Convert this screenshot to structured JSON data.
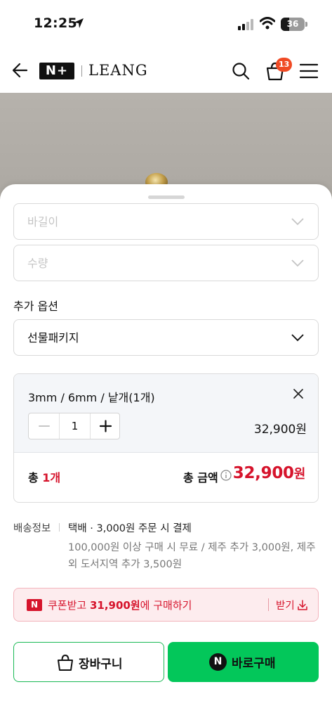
{
  "status_bar": {
    "time": "12:25",
    "battery_level": "36",
    "battery_fraction": 0.36
  },
  "header": {
    "np_logo": "N+",
    "brand_logo": "LEANG",
    "cart_count": "13"
  },
  "sheet": {
    "select_size_placeholder": "바길이",
    "select_qty_placeholder": "수량",
    "extra_options_label": "추가 옵션",
    "extra_option_value": "선물패키지",
    "selected_option": {
      "name": "3mm / 6mm / 낱개(1개)",
      "quantity": "1",
      "price": "32,900원"
    },
    "total": {
      "count_prefix": "총 ",
      "count_value": "1개",
      "amount_label": "총 금액",
      "amount_number": "32,900",
      "amount_unit": "원"
    },
    "delivery": {
      "label": "배송정보",
      "main": "택배 · 3,000원 주문 시 결제",
      "sub": "100,000원 이상 구매 시 무료 / 제주 추가 3,000원, 제주 외 도서지역 추가 3,500원"
    },
    "coupon": {
      "badge": "N",
      "text_prefix": "쿠폰받고 ",
      "text_amount": "31,900원",
      "text_suffix": "에 구매하기",
      "get_label": "받기"
    },
    "actions": {
      "cart_label": "장바구니",
      "buy_label": "바로구매",
      "buy_icon_letter": "N"
    }
  },
  "colors": {
    "accent_red": "#d6142c",
    "naver_green": "#03c75a",
    "badge_orange": "#f04a24"
  }
}
